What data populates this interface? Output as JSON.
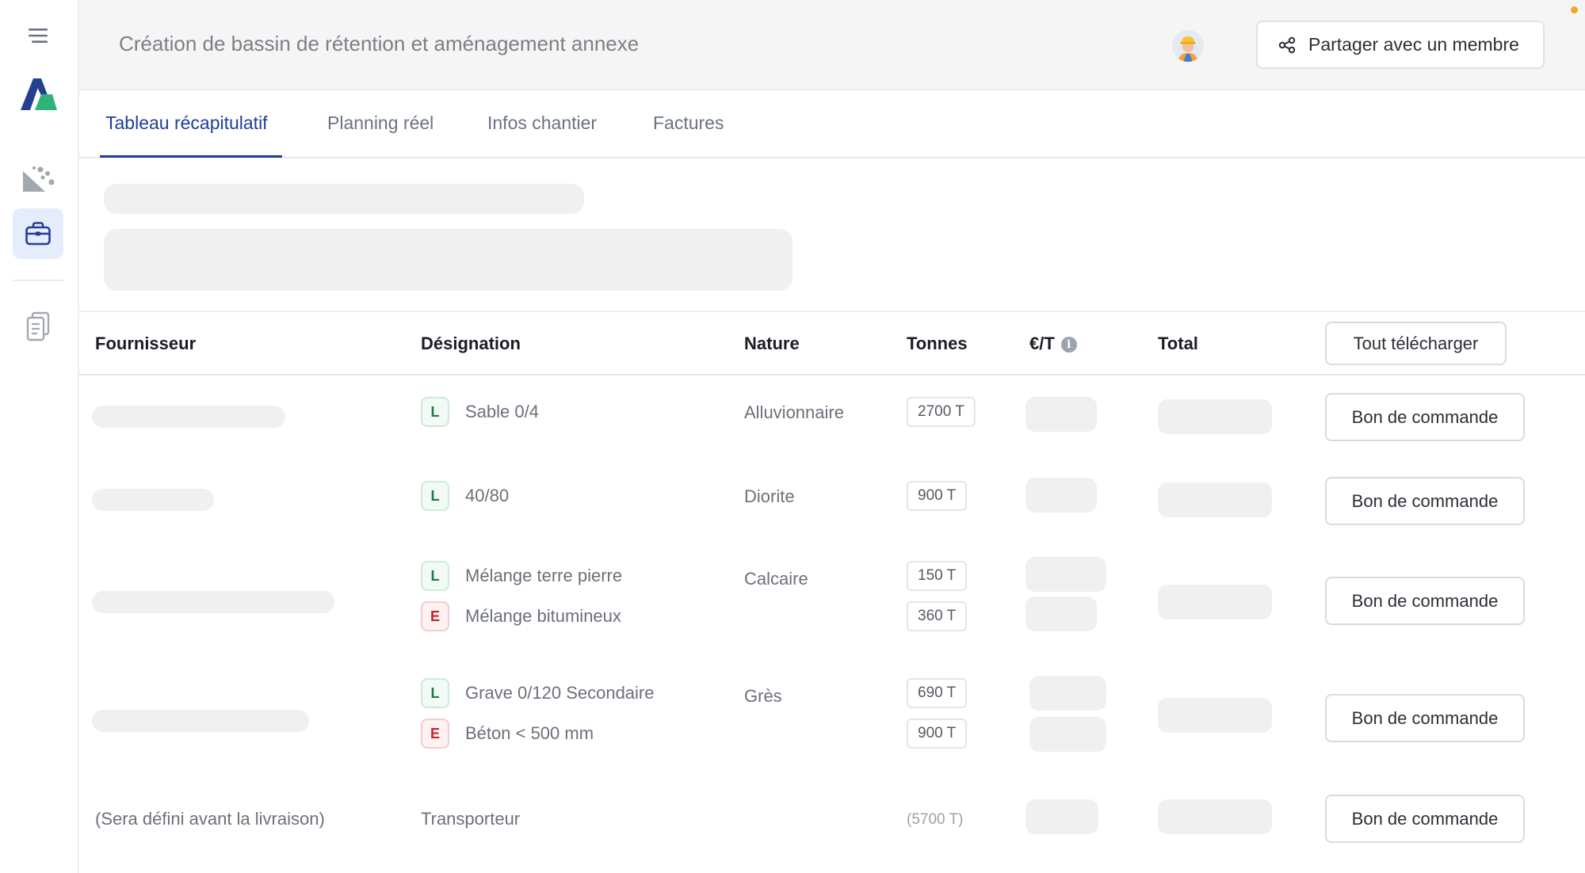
{
  "header": {
    "title": "Création de bassin de rétention et aménagement annexe",
    "share_label": "Partager avec un membre"
  },
  "sidebar": {
    "items": [
      {
        "icon": "menu-icon"
      },
      {
        "icon": "logo"
      },
      {
        "icon": "materials-icon"
      },
      {
        "icon": "briefcase-icon",
        "active": true
      },
      {
        "icon": "clipboard-icon"
      }
    ]
  },
  "tabs": [
    {
      "label": "Tableau récapitulatif",
      "active": true
    },
    {
      "label": "Planning réel"
    },
    {
      "label": "Infos chantier"
    },
    {
      "label": "Factures"
    }
  ],
  "table": {
    "headers": {
      "supplier": "Fournisseur",
      "designation": "Désignation",
      "nature": "Nature",
      "tonnes": "Tonnes",
      "price": "€/T",
      "total": "Total",
      "download_all": "Tout télécharger"
    },
    "order_button": "Bon de commande",
    "rows": [
      {
        "items": [
          {
            "type": "L",
            "name": "Sable 0/4",
            "tonnes": "2700 T"
          }
        ],
        "nature": "Alluvionnaire"
      },
      {
        "items": [
          {
            "type": "L",
            "name": "40/80",
            "tonnes": "900 T"
          }
        ],
        "nature": "Diorite"
      },
      {
        "items": [
          {
            "type": "L",
            "name": "Mélange terre pierre",
            "tonnes": "150 T"
          },
          {
            "type": "E",
            "name": "Mélange bitumineux",
            "tonnes": "360 T"
          }
        ],
        "nature": "Calcaire"
      },
      {
        "items": [
          {
            "type": "L",
            "name": "Grave 0/120 Secondaire",
            "tonnes": "690 T"
          },
          {
            "type": "E",
            "name": "Béton < 500 mm",
            "tonnes": "900 T"
          }
        ],
        "nature": "Grès"
      }
    ],
    "transport_row": {
      "supplier": "(Sera défini avant la livraison)",
      "designation": "Transporteur",
      "tonnes": "(5700 T)"
    }
  },
  "colors": {
    "accent": "#1f3f9a",
    "badge_L": "#1f7a45",
    "badge_E": "#c0262d",
    "skeleton": "#f0f0f1"
  }
}
